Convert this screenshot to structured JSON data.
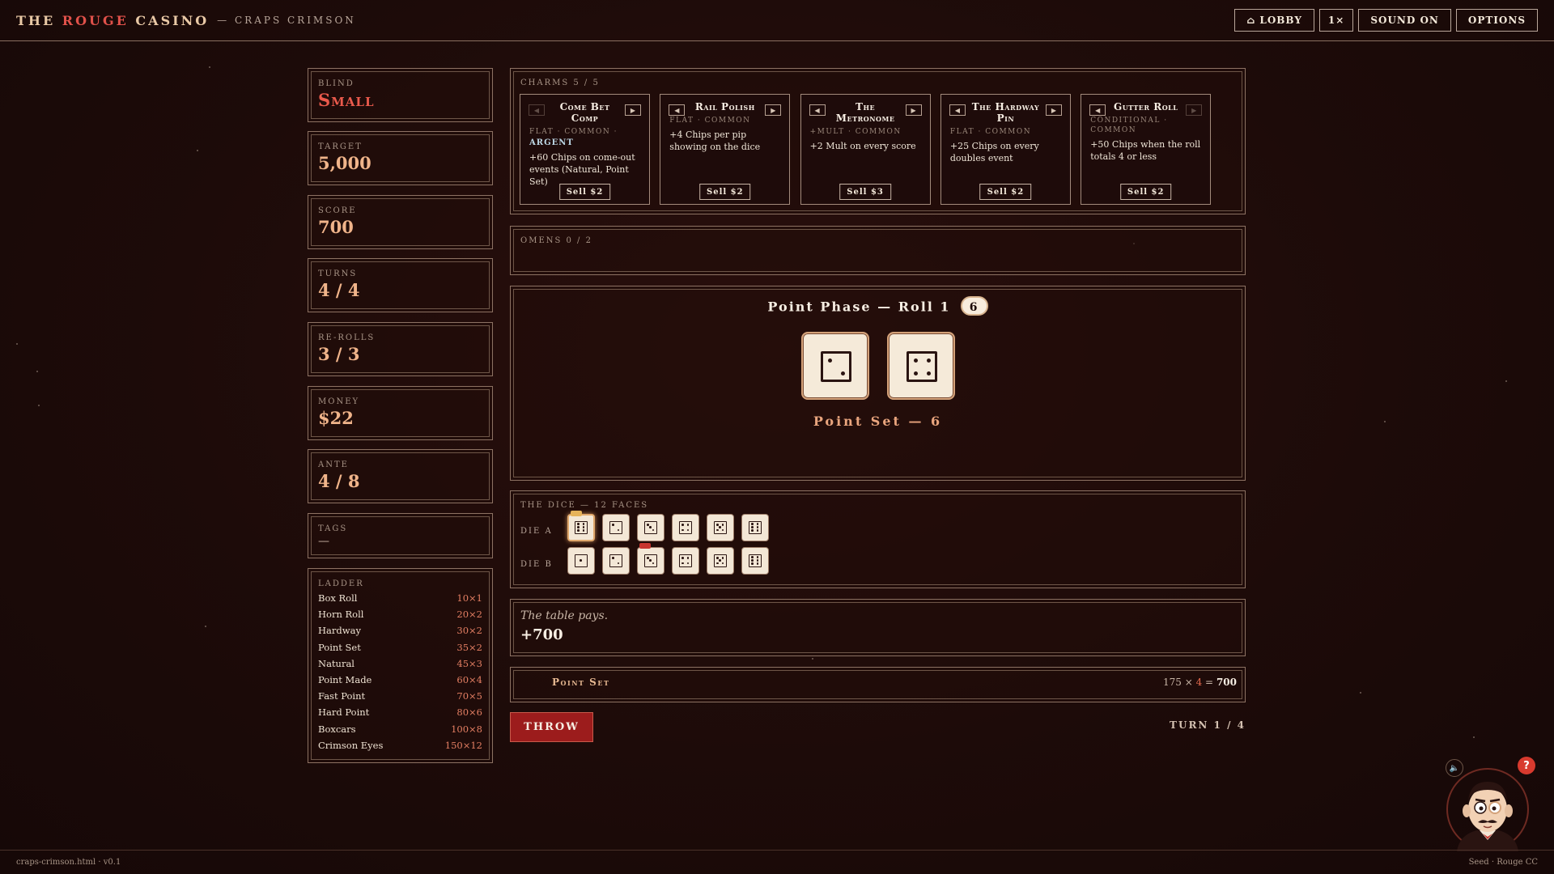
{
  "header": {
    "brand_pre": "The ",
    "brand_rouge": "Rouge",
    "brand_post": " Casino",
    "subtitle": "— Craps Crimson",
    "buttons": {
      "lobby": "⌂ Lobby",
      "speed": "1×",
      "sound": "Sound On",
      "options": "Options"
    }
  },
  "stats": {
    "blind": {
      "label": "Blind",
      "value": "Small"
    },
    "target": {
      "label": "Target",
      "value": "5,000"
    },
    "score": {
      "label": "Score",
      "value": "700"
    },
    "turns": {
      "label": "Turns",
      "value": "4 / 4"
    },
    "rerolls": {
      "label": "Re-Rolls",
      "value": "3 / 3"
    },
    "money": {
      "label": "Money",
      "value": "$22"
    },
    "ante": {
      "label": "Ante",
      "value": "4 / 8"
    },
    "tags": {
      "label": "Tags",
      "value": "—"
    }
  },
  "ladder": {
    "label": "Ladder",
    "rows": [
      {
        "name": "Box Roll",
        "value": "10×1"
      },
      {
        "name": "Horn Roll",
        "value": "20×2"
      },
      {
        "name": "Hardway",
        "value": "30×2"
      },
      {
        "name": "Point Set",
        "value": "35×2"
      },
      {
        "name": "Natural",
        "value": "45×3"
      },
      {
        "name": "Point Made",
        "value": "60×4"
      },
      {
        "name": "Fast Point",
        "value": "70×5"
      },
      {
        "name": "Hard Point",
        "value": "80×6"
      },
      {
        "name": "Boxcars",
        "value": "100×8"
      },
      {
        "name": "Crimson Eyes",
        "value": "150×12"
      }
    ]
  },
  "charms": {
    "label": "Charms 5 / 5",
    "items": [
      {
        "title": "Come Bet Comp",
        "meta": "Flat · Common ·",
        "rarity": "Argent",
        "desc": "+60 Chips on come-out events (Natural, Point Set)",
        "sell": "Sell $2"
      },
      {
        "title": "Rail Polish",
        "meta": "Flat · Common",
        "rarity": "",
        "desc": "+4 Chips per pip showing on the dice",
        "sell": "Sell $2"
      },
      {
        "title": "The Metronome",
        "meta": "+Mult · Common",
        "rarity": "",
        "desc": "+2 Mult on every score",
        "sell": "Sell $3"
      },
      {
        "title": "The Hardway Pin",
        "meta": "Flat · Common",
        "rarity": "",
        "desc": "+25 Chips on every doubles event",
        "sell": "Sell $2"
      },
      {
        "title": "Gutter Roll",
        "meta": "Conditional · Common",
        "rarity": "",
        "desc": "+50 Chips when the roll totals 4 or less",
        "sell": "Sell $2"
      }
    ]
  },
  "omens": {
    "label": "Omens 0 / 2"
  },
  "roll": {
    "title": "Point Phase — Roll 1",
    "badge": "6",
    "dice": [
      2,
      4
    ],
    "result": "Point Set — 6"
  },
  "dice_faces": {
    "label": "The Dice — 12 Faces",
    "die_a": {
      "label": "Die A",
      "faces": [
        6,
        2,
        3,
        4,
        5,
        6
      ],
      "active_index": 0,
      "tag_index": 0,
      "tag_color": "gold"
    },
    "die_b": {
      "label": "Die B",
      "faces": [
        1,
        2,
        3,
        4,
        5,
        6
      ],
      "tag_index": 2,
      "tag_color": "red"
    }
  },
  "pays": {
    "text": "The table pays.",
    "value": "+700"
  },
  "hand": {
    "name": "Point Set",
    "chips": "175",
    "times": "×",
    "mult": "4",
    "equals": "=",
    "total": "700"
  },
  "controls": {
    "throw": "Throw",
    "turn": "Turn 1 / 4"
  },
  "footer": {
    "file": "craps-crimson.html · v0.1",
    "seed": "Seed · Rouge CC"
  },
  "colors": {
    "accent_red": "#9c1c1c",
    "value_orange": "#f0b48a",
    "blind_red": "#ea5a4c"
  }
}
